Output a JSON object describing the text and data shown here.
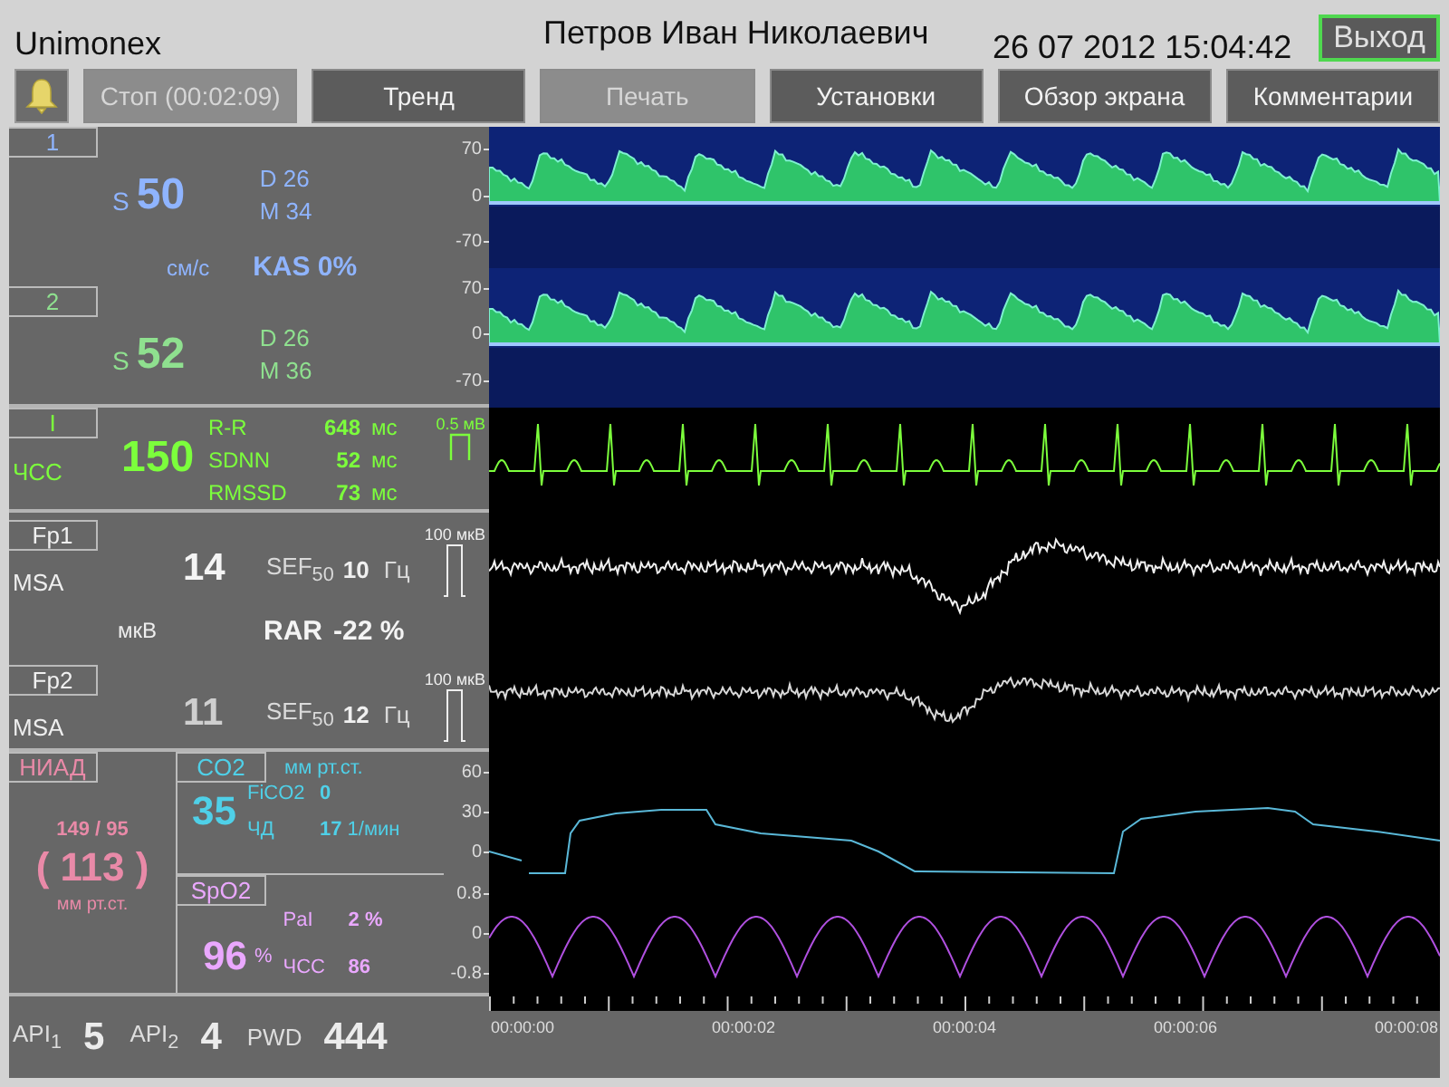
{
  "header": {
    "app_name": "Unimonex",
    "patient": "Петров Иван Николаевич",
    "datetime": "26 07 2012 15:04:42",
    "exit_button": "Выход"
  },
  "toolbar": [
    {
      "label": "Стоп (00:02:09)",
      "disabled": true
    },
    {
      "label": "Тренд",
      "disabled": false
    },
    {
      "label": "Печать",
      "disabled": true
    },
    {
      "label": "Установки",
      "disabled": false
    },
    {
      "label": "Обзор экрана",
      "disabled": false
    },
    {
      "label": "Комментарии",
      "disabled": false
    }
  ],
  "doppler": {
    "channels": [
      {
        "label": "1",
        "color": "#8fb4ff",
        "s_label": "S",
        "s_value": "50",
        "d": "D 26",
        "m": "M 34",
        "axis": [
          "70",
          "0",
          "-70"
        ]
      },
      {
        "label": "2",
        "color": "#8fe08f",
        "s_label": "S",
        "s_value": "52",
        "d": "D 26",
        "m": "M 36",
        "axis": [
          "70",
          "0",
          "-70"
        ]
      }
    ],
    "unit": "см/с",
    "kas": "KAS 0%"
  },
  "ecg": {
    "lead": "I",
    "hr_label": "ЧСС",
    "hr": "150",
    "metrics": [
      {
        "name": "R-R",
        "value": "648",
        "unit": "мс"
      },
      {
        "name": "SDNN",
        "value": "52",
        "unit": "мс"
      },
      {
        "name": "RMSSD",
        "value": "73",
        "unit": "мс"
      }
    ],
    "scale": "0.5 мВ"
  },
  "eeg": {
    "channels": [
      {
        "label": "Fp1",
        "measure": "MSA",
        "value": "14",
        "sef_label": "SEF$_{50}$",
        "sef_value": "10",
        "sef_unit": "Гц",
        "scale": "100 мкВ"
      },
      {
        "label": "Fp2",
        "measure": "MSA",
        "value": "11",
        "sef_label": "SEF$_{50}$",
        "sef_value": "12",
        "sef_unit": "Гц",
        "scale": "100 мкВ"
      }
    ],
    "unit": "мкВ",
    "rar_label": "RAR",
    "rar": "-22 %"
  },
  "niad": {
    "label": "НИАД",
    "pressure": "149 / 95",
    "mean": "( 113 )",
    "unit": "мм рт.ст."
  },
  "co2": {
    "label": "CO2",
    "unit": "мм рт.ст.",
    "value": "35",
    "fico2_label": "FiCO2",
    "fico2": "0",
    "rr_label": "ЧД",
    "rr": "17",
    "rr_unit": "1/мин",
    "axis": [
      "60",
      "30",
      "0"
    ]
  },
  "spo2": {
    "label": "SpO2",
    "value": "96",
    "unit": "%",
    "pi_label": "PaI",
    "pi": "2 %",
    "hr_label": "ЧСС",
    "hr": "86",
    "axis": [
      "0.8",
      "0",
      "-0.8"
    ]
  },
  "indices": [
    {
      "name": "API$_{1}$",
      "value": "5"
    },
    {
      "name": "API$_{2}$",
      "value": "4"
    },
    {
      "name": "PWD",
      "value": "444"
    }
  ],
  "time_axis": [
    "00:00:00",
    "00:00:02",
    "00:00:04",
    "00:00:06",
    "00:00:08"
  ]
}
